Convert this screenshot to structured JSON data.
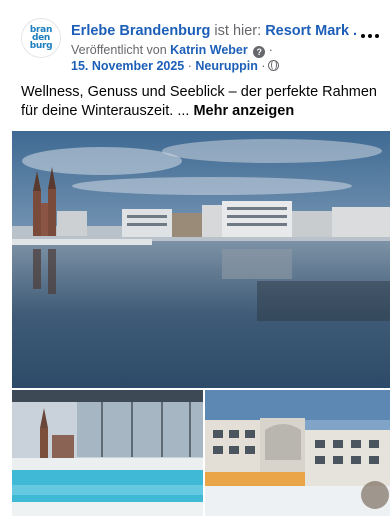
{
  "post": {
    "avatar_text": "bran\nden\nburg",
    "page_name": "Erlebe Brandenburg",
    "is_here_text": "ist hier:",
    "location": "Resort Mark ...",
    "published_by_text": "Veröffentlicht von",
    "author": "Katrin Weber",
    "date": "15. November 2025",
    "place": "Neuruppin",
    "caption": "Wellness, Genuss und Seeblick – der perfekte Rahmen für deine Winterauszeit. ...",
    "show_more": "Mehr anzeigen"
  },
  "icons": [
    "info-icon",
    "globe-icon",
    "more-options-icon"
  ],
  "colors": {
    "link": "#1d5fb8",
    "muted": "#65676b",
    "text": "#050505"
  }
}
